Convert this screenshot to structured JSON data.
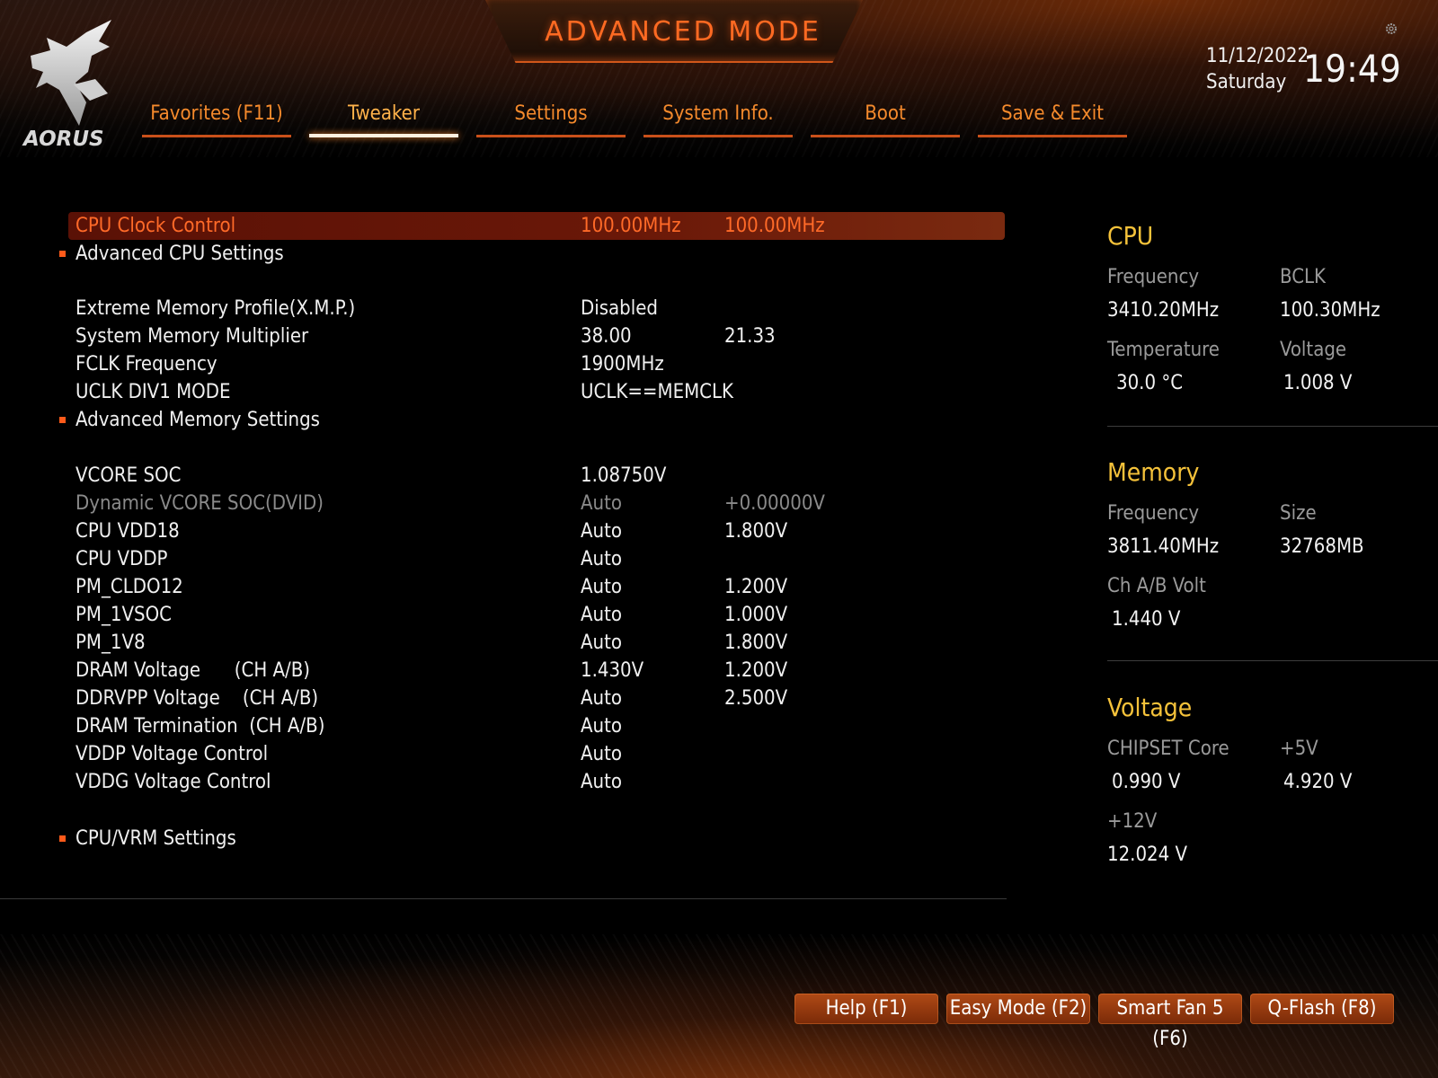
{
  "header": {
    "mode_title": "ADVANCED MODE",
    "logo_text": "AORUS",
    "date": "11/12/2022",
    "day": "Saturday",
    "time": "19:49",
    "icons": {
      "settings": "gear-icon",
      "logo": "eagle-logo-icon"
    }
  },
  "tabs": [
    {
      "label": "Favorites (F11)",
      "active": false
    },
    {
      "label": "Tweaker",
      "active": true
    },
    {
      "label": "Settings",
      "active": false
    },
    {
      "label": "System Info.",
      "active": false
    },
    {
      "label": "Boot",
      "active": false
    },
    {
      "label": "Save & Exit",
      "active": false
    }
  ],
  "settings": [
    {
      "label": "CPU Clock Control",
      "v1": "100.00MHz",
      "v2": "100.00MHz",
      "selected": true
    },
    {
      "label": "Advanced CPU Settings",
      "submenu": true
    },
    {
      "label": "Extreme Memory Profile(X.M.P.)",
      "v1": "Disabled",
      "v2": ""
    },
    {
      "label": "System Memory Multiplier",
      "v1": "38.00",
      "v2": "21.33"
    },
    {
      "label": "FCLK Frequency",
      "v1": "1900MHz",
      "v2": ""
    },
    {
      "label": "UCLK DIV1 MODE",
      "v1": "UCLK==MEMCLK",
      "v2": ""
    },
    {
      "label": "Advanced Memory Settings",
      "submenu": true
    },
    {
      "label": "VCORE SOC",
      "v1": "1.08750V",
      "v2": ""
    },
    {
      "label": "Dynamic VCORE SOC(DVID)",
      "v1": "Auto",
      "v2": "+0.00000V",
      "disabled": true
    },
    {
      "label": "CPU VDD18",
      "v1": "Auto",
      "v2": "1.800V"
    },
    {
      "label": "CPU VDDP",
      "v1": "Auto",
      "v2": ""
    },
    {
      "label": "PM_CLDO12",
      "v1": "Auto",
      "v2": "1.200V"
    },
    {
      "label": "PM_1VSOC",
      "v1": "Auto",
      "v2": "1.000V"
    },
    {
      "label": "PM_1V8",
      "v1": "Auto",
      "v2": "1.800V"
    },
    {
      "label": "DRAM Voltage      (CH A/B)",
      "v1": "1.430V",
      "v2": "1.200V"
    },
    {
      "label": "DDRVPP Voltage    (CH A/B)",
      "v1": "Auto",
      "v2": "2.500V"
    },
    {
      "label": "DRAM Termination  (CH A/B)",
      "v1": "Auto",
      "v2": ""
    },
    {
      "label": "VDDP Voltage Control",
      "v1": "Auto",
      "v2": ""
    },
    {
      "label": "VDDG Voltage Control",
      "v1": "Auto",
      "v2": ""
    },
    {
      "label": "CPU/VRM Settings",
      "submenu": true
    }
  ],
  "panel": {
    "cpu": {
      "heading": "CPU",
      "frequency_label": "Frequency",
      "frequency": "3410.20MHz",
      "bclk_label": "BCLK",
      "bclk": "100.30MHz",
      "temperature_label": "Temperature",
      "temperature": "30.0 °C",
      "voltage_label": "Voltage",
      "voltage": "1.008 V"
    },
    "memory": {
      "heading": "Memory",
      "frequency_label": "Frequency",
      "frequency": "3811.40MHz",
      "size_label": "Size",
      "size": "32768MB",
      "volt_label": "Ch A/B Volt",
      "volt": "1.440 V"
    },
    "voltage": {
      "heading": "Voltage",
      "chipset_label": "CHIPSET Core",
      "chipset": "0.990 V",
      "p5v_label": "+5V",
      "p5v": "4.920 V",
      "p12v_label": "+12V",
      "p12v": "12.024 V"
    }
  },
  "footer": {
    "buttons": [
      {
        "label": "Help (F1)"
      },
      {
        "label": "Easy Mode (F2)"
      },
      {
        "label": "Smart Fan 5 (F6)"
      },
      {
        "label": "Q-Flash (F8)"
      }
    ]
  },
  "colors": {
    "accent_orange": "#ff6a22",
    "tab_orange": "#f58a2c",
    "panel_heading": "#f5c23a",
    "selected_row_bg": "#5a1106"
  }
}
